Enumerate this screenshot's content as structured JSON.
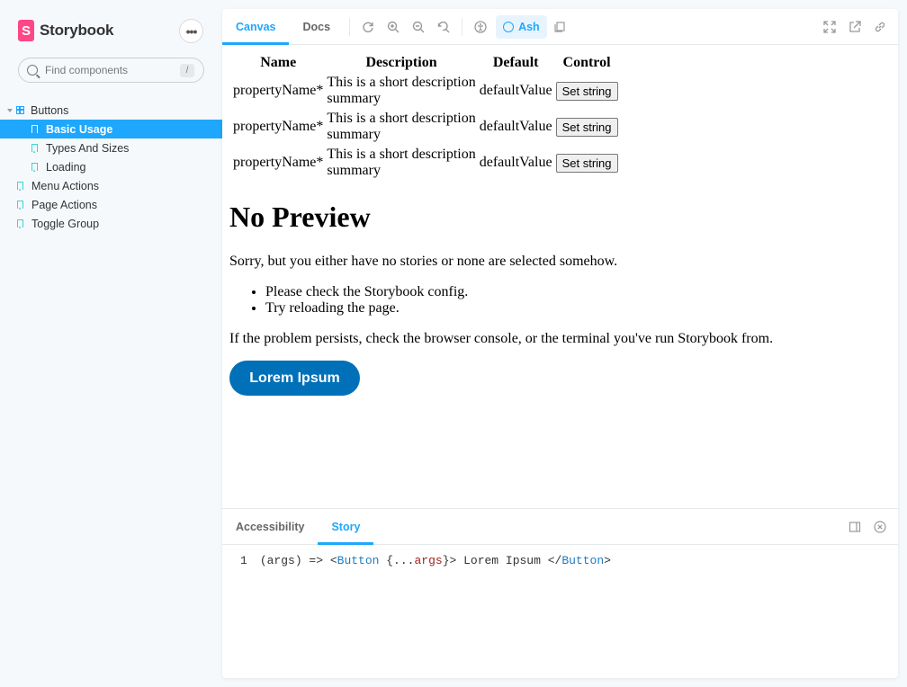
{
  "sidebar": {
    "brand": "Storybook",
    "brand_logo": "S",
    "menu_icon": "ellipsis-icon",
    "search": {
      "placeholder": "Find components",
      "shortcut": "/"
    },
    "tree": [
      {
        "label": "Buttons",
        "type": "component",
        "level": 0,
        "expanded": true
      },
      {
        "label": "Basic Usage",
        "type": "story",
        "level": 1,
        "selected": true
      },
      {
        "label": "Types And Sizes",
        "type": "story",
        "level": 1
      },
      {
        "label": "Loading",
        "type": "story",
        "level": 1
      },
      {
        "label": "Menu Actions",
        "type": "story",
        "level": 0
      },
      {
        "label": "Page Actions",
        "type": "story",
        "level": 0
      },
      {
        "label": "Toggle Group",
        "type": "story",
        "level": 0
      }
    ]
  },
  "toolbar": {
    "tabs": [
      "Canvas",
      "Docs"
    ],
    "active_tab": "Canvas",
    "theme_label": "Ash",
    "accent": "#1ea7fd"
  },
  "canvas": {
    "table": {
      "headers": [
        "Name",
        "Description",
        "Default",
        "Control"
      ],
      "rows": [
        {
          "name": "propertyName*",
          "desc_1": "This is a short description",
          "desc_2": "summary",
          "default": "defaultValue",
          "control": "Set string"
        },
        {
          "name": "propertyName*",
          "desc_1": "This is a short description",
          "desc_2": "summary",
          "default": "defaultValue",
          "control": "Set string"
        },
        {
          "name": "propertyName*",
          "desc_1": "This is a short description",
          "desc_2": "summary",
          "default": "defaultValue",
          "control": "Set string"
        }
      ]
    },
    "heading": "No Preview",
    "sorry": "Sorry, but you either have no stories or none are selected somehow.",
    "tips": [
      "Please check the Storybook config.",
      "Try reloading the page."
    ],
    "persist": "If the problem persists, check the browser console, or the terminal you've run Storybook from.",
    "button_label": "Lorem Ipsum"
  },
  "addons": {
    "tabs": [
      "Accessibility",
      "Story"
    ],
    "active_tab": "Story",
    "code": {
      "line_number": "1",
      "prefix": "(args) => <",
      "tag_open": "Button",
      "spread_open": " {...",
      "spread_arg": "args",
      "spread_close": "}> Lorem Ipsum </",
      "tag_close": "Button",
      "suffix": ">"
    }
  }
}
